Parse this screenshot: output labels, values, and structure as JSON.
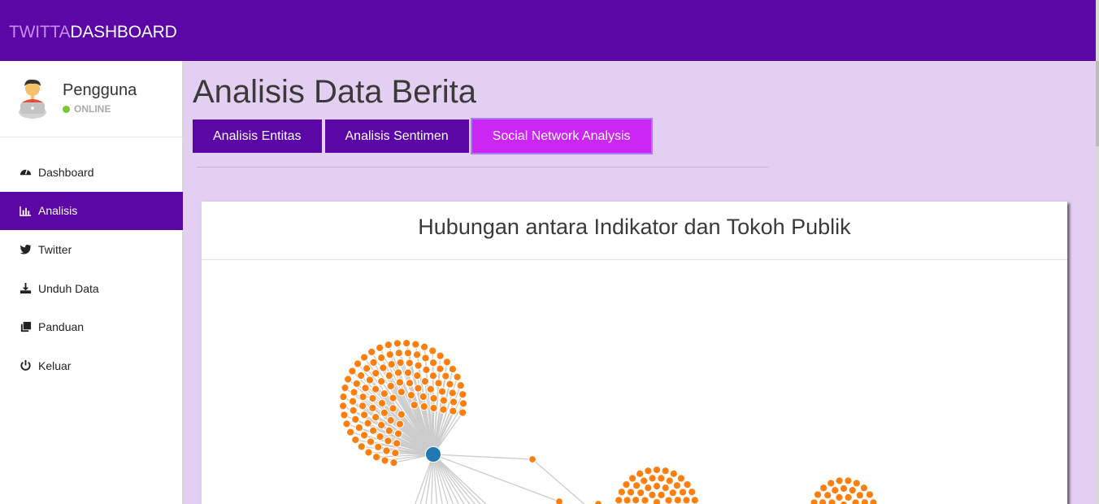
{
  "header": {
    "brand_part1": "TWITTA",
    "brand_part2": "DASHBOARD"
  },
  "profile": {
    "name": "Pengguna",
    "status": "ONLINE"
  },
  "nav": [
    {
      "label": "Dashboard",
      "icon": "dashboard-icon"
    },
    {
      "label": "Analisis",
      "icon": "bar-chart-icon",
      "active": true
    },
    {
      "label": "Twitter",
      "icon": "twitter-icon"
    },
    {
      "label": "Unduh Data",
      "icon": "download-icon"
    },
    {
      "label": "Panduan",
      "icon": "copy-icon"
    },
    {
      "label": "Keluar",
      "icon": "power-icon"
    }
  ],
  "main": {
    "title": "Analisis Data Berita",
    "tabs": [
      {
        "label": "Analisis Entitas"
      },
      {
        "label": "Analisis Sentimen"
      },
      {
        "label": "Social Network Analysis",
        "active": true
      }
    ],
    "card_title": "Hubungan antara Indikator dan Tokoh Publik"
  },
  "colors": {
    "brand": "#5a07a5",
    "accent": "#cc26f5",
    "page_bg": "#e2cff2",
    "hub_node": "#1f77b4",
    "leaf_node": "#ff7f0e",
    "link": "#cccccc"
  }
}
